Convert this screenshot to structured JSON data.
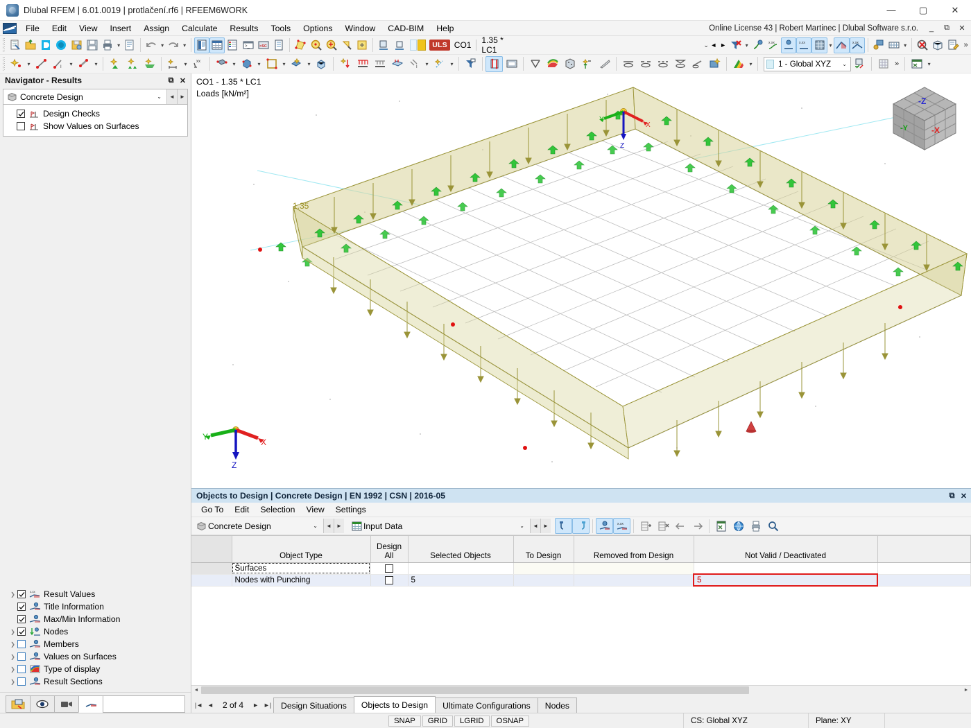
{
  "window": {
    "title": "Dlubal RFEM | 6.01.0019 | protlačení.rf6 | RFEEM6WORK",
    "minimize": "—",
    "maximize": "▢",
    "close": "✕"
  },
  "menubar": {
    "items": [
      "File",
      "Edit",
      "View",
      "Insert",
      "Assign",
      "Calculate",
      "Results",
      "Tools",
      "Options",
      "Window",
      "CAD-BIM",
      "Help"
    ],
    "license": "Online License 43 | Robert Martinec | Dlubal Software s.r.o.",
    "mini_minimize": "_",
    "mini_restore": "⧉",
    "mini_close": "✕"
  },
  "toolbar": {
    "loadcase": {
      "badge": "ULS",
      "combination": "CO1",
      "expression": "1.35 * LC1",
      "dropdown_caret": "⌄",
      "prev": "◄",
      "next": "►"
    },
    "coordinate_system": {
      "value": "1 - Global XYZ",
      "caret": "⌄"
    },
    "overflow": "»"
  },
  "navigator": {
    "title": "Navigator - Results",
    "undock": "⧉",
    "close": "✕",
    "combo": {
      "value": "Concrete Design",
      "caret": "⌄",
      "prev": "◄",
      "next": "►"
    },
    "top_items": [
      {
        "label": "Design Checks",
        "checked": true,
        "icon": "design-check-icon"
      },
      {
        "label": "Show Values on Surfaces",
        "checked": false,
        "icon": "design-check-icon"
      }
    ],
    "bottom_items": [
      {
        "label": "Result Values",
        "checked": true,
        "expandable": true,
        "icon": "result-values-icon"
      },
      {
        "label": "Title Information",
        "checked": true,
        "expandable": false,
        "icon": "info-icon"
      },
      {
        "label": "Max/Min Information",
        "checked": true,
        "expandable": false,
        "icon": "info-icon"
      },
      {
        "label": "Nodes",
        "checked": true,
        "expandable": true,
        "icon": "nodes-icon"
      },
      {
        "label": "Members",
        "checked": false,
        "expandable": true,
        "icon": "info-icon"
      },
      {
        "label": "Values on Surfaces",
        "checked": false,
        "expandable": true,
        "icon": "info-icon"
      },
      {
        "label": "Type of display",
        "checked": false,
        "expandable": true,
        "icon": "colorscale-icon"
      },
      {
        "label": "Result Sections",
        "checked": false,
        "expandable": true,
        "icon": "info-icon"
      }
    ]
  },
  "viewport": {
    "title_line1": "CO1 - 1.35 * LC1",
    "title_line2": "Loads [kN/m²]",
    "load_value_label": "1.35",
    "tripod": {
      "x": "X",
      "y": "Y",
      "z": "Z"
    },
    "navcube": {
      "nx": "-X",
      "ny": "-Y",
      "nz": "-Z"
    }
  },
  "bottom_panel": {
    "title": "Objects to Design | Concrete Design | EN 1992 | CSN | 2016-05",
    "undock": "⧉",
    "close": "✕",
    "menus": [
      "Go To",
      "Edit",
      "Selection",
      "View",
      "Settings"
    ],
    "combo_left": {
      "value": "Concrete Design",
      "caret": "⌄",
      "prev": "◄",
      "next": "►"
    },
    "combo_right": {
      "value": "Input Data",
      "caret": "⌄",
      "prev": "◄",
      "next": "►"
    },
    "table": {
      "columns": [
        {
          "label": "",
          "key": "idx"
        },
        {
          "label": "Object Type",
          "key": "object_type"
        },
        {
          "label": "Design\nAll",
          "key": "design_all",
          "line1": "Design",
          "line2": "All"
        },
        {
          "label": "Selected Objects",
          "key": "selected_objects"
        },
        {
          "label": "To Design",
          "key": "to_design"
        },
        {
          "label": "Removed from Design",
          "key": "removed_from_design"
        },
        {
          "label": "Not Valid / Deactivated",
          "key": "not_valid"
        },
        {
          "label": "",
          "key": "tail"
        }
      ],
      "rows": [
        {
          "object_type": "Surfaces",
          "design_all": false,
          "selected_objects": "",
          "to_design": "",
          "removed_from_design": "",
          "not_valid": "",
          "selected_row": false,
          "focused": true,
          "highlight_not_valid": false
        },
        {
          "object_type": "Nodes with Punching",
          "design_all": false,
          "selected_objects": "5",
          "to_design": "",
          "removed_from_design": "",
          "not_valid": "5",
          "selected_row": true,
          "focused": false,
          "highlight_not_valid": true
        }
      ]
    },
    "pager": {
      "first": "|◄",
      "prev": "◄",
      "text": "2 of 4",
      "next": "►",
      "last": "►|"
    },
    "tabs": [
      {
        "label": "Design Situations",
        "active": false
      },
      {
        "label": "Objects to Design",
        "active": true
      },
      {
        "label": "Ultimate Configurations",
        "active": false
      },
      {
        "label": "Nodes",
        "active": false
      }
    ]
  },
  "statusbar": {
    "buttons": [
      "SNAP",
      "GRID",
      "LGRID",
      "OSNAP"
    ],
    "coordinate_system": "CS: Global XYZ",
    "plane": "Plane: XY"
  },
  "colors": {
    "accent_blue": "#2b6aa8",
    "uls_red": "#c0392b",
    "warning_red": "#e01b1b",
    "load_olive": "#b3ae4e",
    "support_green": "#22b030",
    "axis_x": "#e02020",
    "axis_y": "#18b018",
    "axis_z": "#1515c0",
    "panel_title_bg": "#cfe3f2"
  }
}
